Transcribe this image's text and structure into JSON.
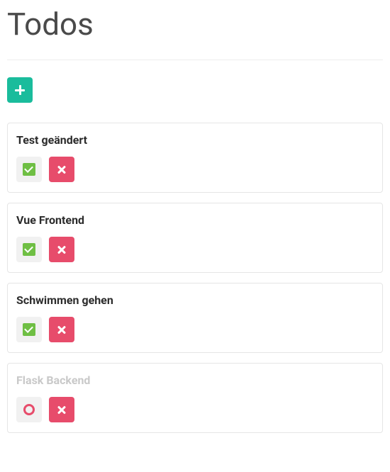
{
  "title": "Todos",
  "todos": [
    {
      "title": "Test geändert",
      "done": false
    },
    {
      "title": "Vue Frontend",
      "done": false
    },
    {
      "title": "Schwimmen gehen",
      "done": false
    },
    {
      "title": "Flask Backend",
      "done": true
    }
  ]
}
